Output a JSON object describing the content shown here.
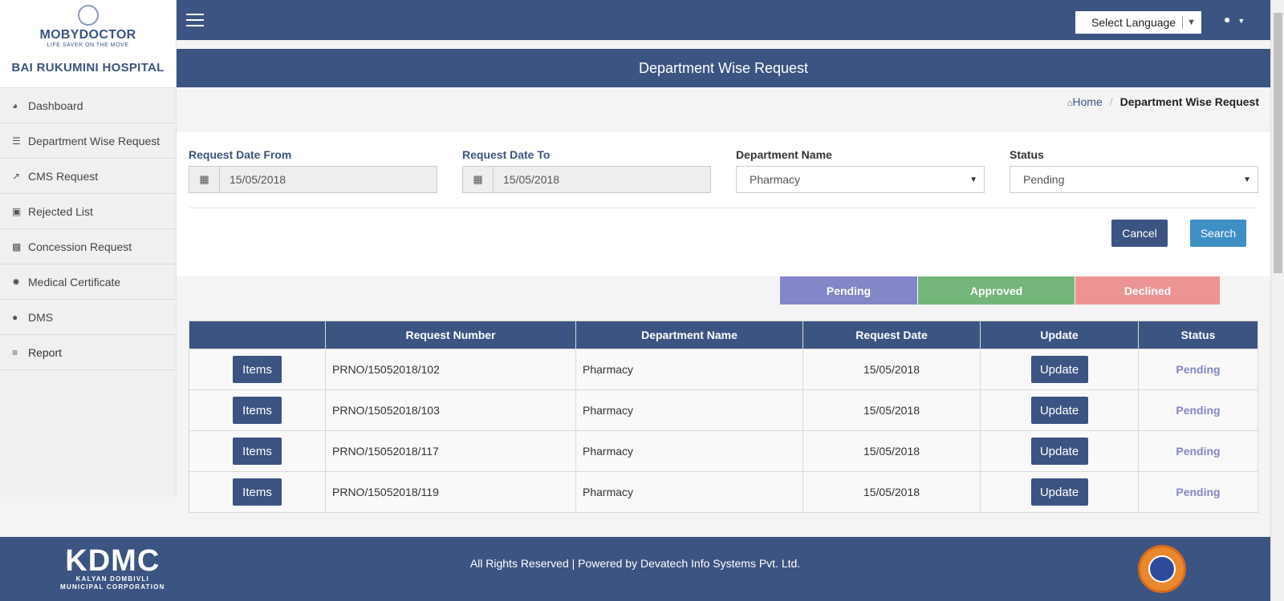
{
  "brand": {
    "logo_name": "MOBYDOCTOR",
    "logo_tagline": "LIFE SAVER ON THE MOVE",
    "hospital_name": "BAI RUKUMINI HOSPITAL"
  },
  "sidebar": {
    "items": [
      {
        "label": "Dashboard",
        "icon": "dashboard-icon"
      },
      {
        "label": "Department Wise Request",
        "icon": "database-icon"
      },
      {
        "label": "CMS Request",
        "icon": "external-link-icon"
      },
      {
        "label": "Rejected List",
        "icon": "share-square-icon"
      },
      {
        "label": "Concession Request",
        "icon": "money-icon"
      },
      {
        "label": "Medical Certificate",
        "icon": "certificate-icon"
      },
      {
        "label": "DMS",
        "icon": "user-icon"
      },
      {
        "label": "Report",
        "icon": "list-icon"
      }
    ]
  },
  "header": {
    "language_label": "Select Language"
  },
  "page": {
    "title": "Department Wise Request",
    "breadcrumb_home": "Home",
    "breadcrumb_current": "Department Wise Request"
  },
  "filters": {
    "date_from_label": "Request Date From",
    "date_from_value": "15/05/2018",
    "date_to_label": "Request Date To",
    "date_to_value": "15/05/2018",
    "department_label": "Department Name",
    "department_value": "Pharmacy",
    "status_label": "Status",
    "status_value": "Pending",
    "cancel_label": "Cancel",
    "search_label": "Search"
  },
  "legend": {
    "pending": "Pending",
    "approved": "Approved",
    "declined": "Declined",
    "colors": {
      "pending": "#8387c7",
      "approved": "#74b57a",
      "declined": "#ec9494"
    }
  },
  "table": {
    "headers": [
      "",
      "Request Number",
      "Department Name",
      "Request Date",
      "Update",
      "Status"
    ],
    "items_label": "Items",
    "update_label": "Update",
    "rows": [
      {
        "request_number": "PRNO/15052018/102",
        "department": "Pharmacy",
        "date": "15/05/2018",
        "status": "Pending"
      },
      {
        "request_number": "PRNO/15052018/103",
        "department": "Pharmacy",
        "date": "15/05/2018",
        "status": "Pending"
      },
      {
        "request_number": "PRNO/15052018/117",
        "department": "Pharmacy",
        "date": "15/05/2018",
        "status": "Pending"
      },
      {
        "request_number": "PRNO/15052018/119",
        "department": "Pharmacy",
        "date": "15/05/2018",
        "status": "Pending"
      }
    ]
  },
  "footer": {
    "logo_big": "KDMC",
    "logo_line1": "KALYAN DOMBIVLI",
    "logo_line2": "MUNICIPAL CORPORATION",
    "text": "All Rights Reserved | Powered by Devatech Info Systems Pvt. Ltd."
  },
  "theme": {
    "primary": "#3c5482",
    "search_button": "#3d8fc4"
  }
}
